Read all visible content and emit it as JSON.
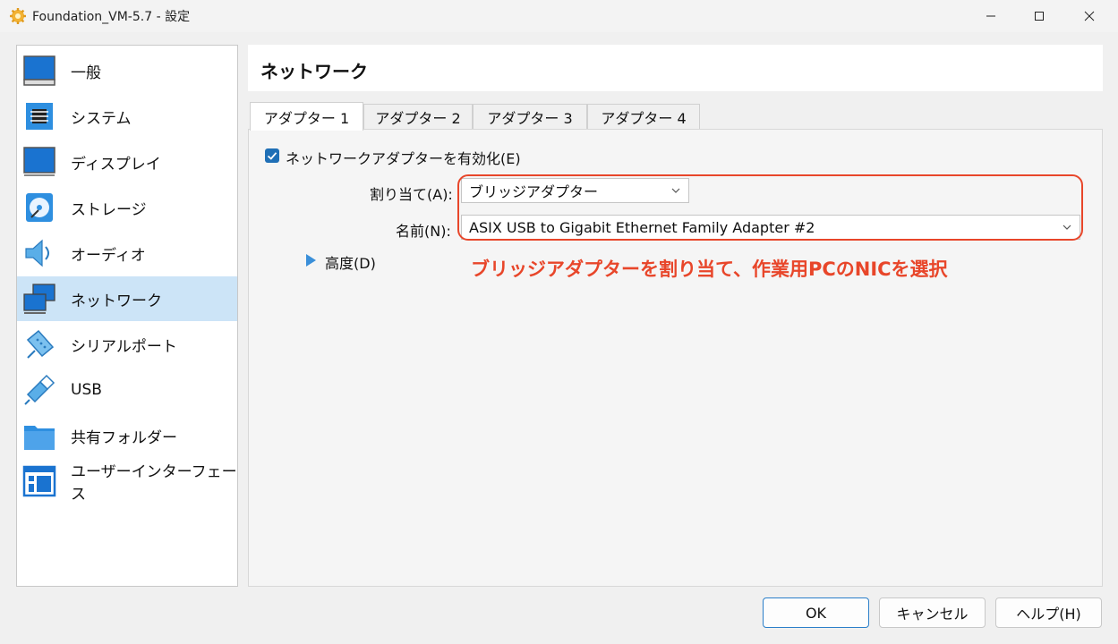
{
  "window": {
    "title": "Foundation_VM-5.7 - 設定",
    "icons": [
      "gear-icon",
      "minimize-icon",
      "maximize-icon",
      "close-icon"
    ]
  },
  "sidebar": {
    "selected_index": 5,
    "items": [
      {
        "label": "一般",
        "icon": "general-icon"
      },
      {
        "label": "システム",
        "icon": "chip-icon"
      },
      {
        "label": "ディスプレイ",
        "icon": "monitor-icon"
      },
      {
        "label": "ストレージ",
        "icon": "disk-icon"
      },
      {
        "label": "オーディオ",
        "icon": "speaker-icon"
      },
      {
        "label": "ネットワーク",
        "icon": "network-icon"
      },
      {
        "label": "シリアルポート",
        "icon": "serial-port-icon"
      },
      {
        "label": "USB",
        "icon": "usb-icon"
      },
      {
        "label": "共有フォルダー",
        "icon": "folder-icon"
      },
      {
        "label": "ユーザーインターフェース",
        "icon": "ui-icon"
      }
    ]
  },
  "main": {
    "title": "ネットワーク",
    "tabs": [
      {
        "label": "アダプター 1",
        "active": true
      },
      {
        "label": "アダプター 2",
        "active": false
      },
      {
        "label": "アダプター 3",
        "active": false
      },
      {
        "label": "アダプター 4",
        "active": false
      }
    ],
    "enable_checkbox": {
      "label": "ネットワークアダプターを有効化(E)",
      "checked": true
    },
    "attached_to": {
      "label": "割り当て(A):",
      "value": "ブリッジアダプター"
    },
    "name": {
      "label": "名前(N):",
      "value": "ASIX USB to Gigabit Ethernet Family Adapter #2"
    },
    "advanced": {
      "label": "高度(D)"
    }
  },
  "annotation": {
    "text": "ブリッジアダプターを割り当て、作業用PCのNICを選択",
    "color": "#e8462a"
  },
  "buttons": {
    "ok": "OK",
    "cancel": "キャンセル",
    "help": "ヘルプ(H)"
  },
  "colors": {
    "accent": "#1f6fb6",
    "selection": "#cce4f7"
  }
}
